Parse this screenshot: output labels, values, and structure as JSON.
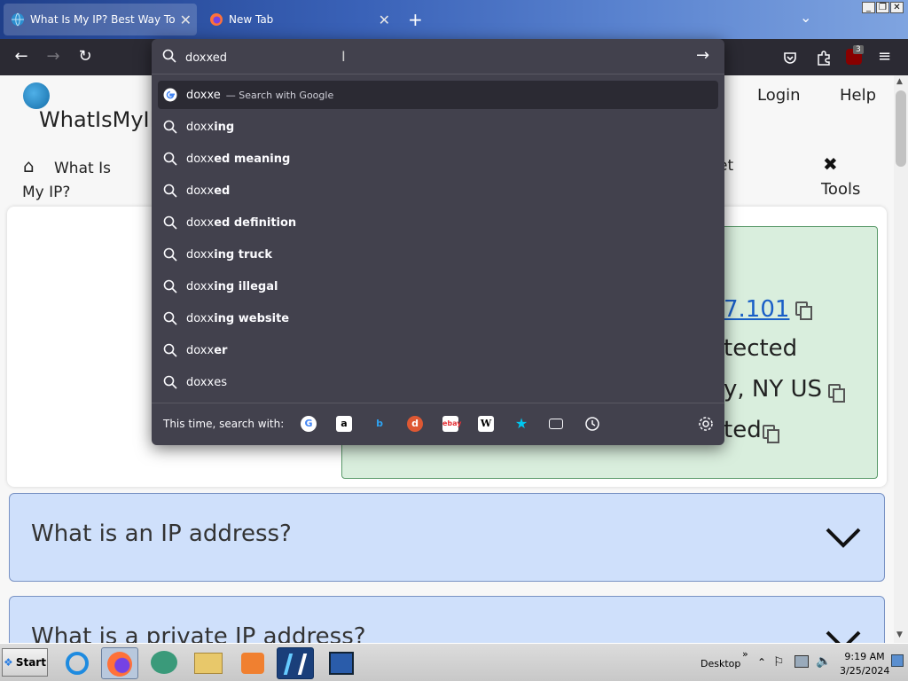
{
  "window": {
    "tabs": [
      {
        "title": "What Is My IP? Best Way To Check"
      },
      {
        "title": "New Tab"
      }
    ],
    "badge_count": "3"
  },
  "urlbar": {
    "value": "doxxed",
    "typed_prefix": "doxx",
    "top_suggestion": {
      "text": "doxxe",
      "suffix": "— Search with Google"
    },
    "suggestions": [
      {
        "rest": "ing"
      },
      {
        "rest": "ed meaning"
      },
      {
        "rest": "ed"
      },
      {
        "rest": "ed definition"
      },
      {
        "rest": "ing truck"
      },
      {
        "rest": "ing illegal"
      },
      {
        "rest": "ing website"
      },
      {
        "rest": "er"
      },
      {
        "rest": "es"
      }
    ],
    "oneoff_label": "This time, search with:"
  },
  "page": {
    "site_name": "WhatIsMyIP",
    "login": "Login",
    "help": "Help",
    "nav_home": "What Is My IP?",
    "nav_partial": "et",
    "nav_tools": "Tools",
    "ip_partial": "7.101",
    "line2": "tected",
    "line3": "y, NY US",
    "line4": "ted",
    "faq": [
      "What is an IP address?",
      "What is a private IP address?"
    ]
  },
  "taskbar": {
    "start": "Start",
    "desktop": "Desktop",
    "time": "9:19 AM",
    "date": "3/25/2024"
  },
  "colors": {
    "toolbar_bg": "#2b2a33",
    "panel_bg": "#42414d",
    "ip_box_bg": "#d9eedd",
    "faq_bg": "#cfe0fb",
    "link": "#1a5fc7"
  }
}
